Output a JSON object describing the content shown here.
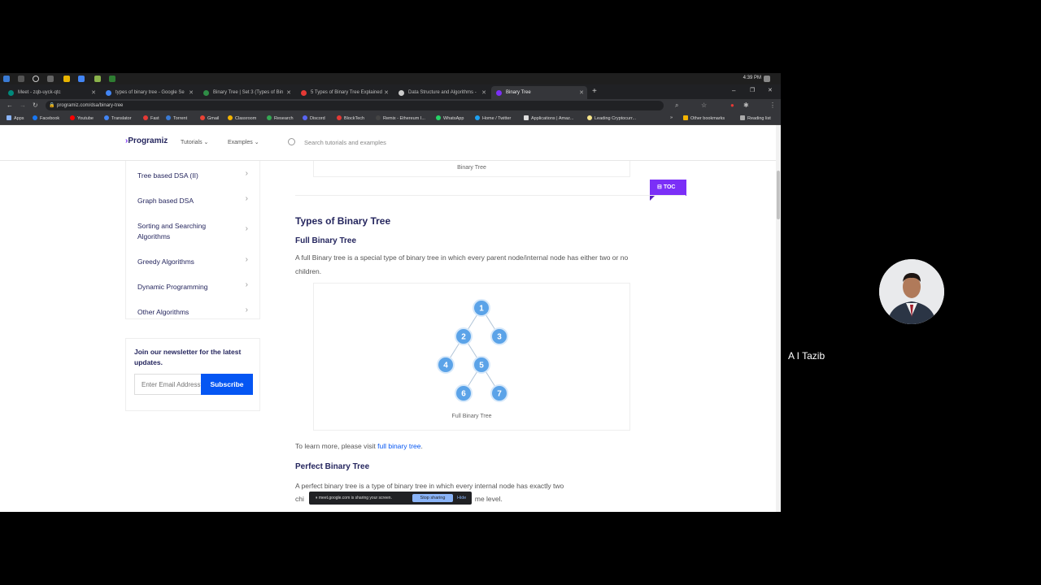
{
  "taskbar": {
    "clock": "4:39 PM"
  },
  "tabs": [
    {
      "label": "Meet - zqb-uyck-qtc",
      "color": "#00897b"
    },
    {
      "label": "types of binary tree - Google Se",
      "color": "#4285f4"
    },
    {
      "label": "Binary Tree | Set 3 (Types of Bin",
      "color": "#2f8d46"
    },
    {
      "label": "5 Types of Binary Tree Explained",
      "color": "#e53935"
    },
    {
      "label": "Data Structure and Algorithms -",
      "color": "#cccccc"
    },
    {
      "label": "Binary Tree",
      "color": "#7b2ff7"
    }
  ],
  "address": {
    "url": "programiz.com/dsa/binary-tree"
  },
  "bookmarks": [
    "Apps",
    "Facebook",
    "Youtube",
    "Translator",
    "Fast",
    "Torrent",
    "Gmail",
    "Classroom",
    "Research",
    "Discord",
    "BlockTech",
    "Remix - Ethereum I...",
    "WhatsApp",
    "Home / Twitter",
    "Applications | Amaz...",
    "Leading Cryptocurr..."
  ],
  "bookmarks_right": [
    "Other bookmarks",
    "Reading list"
  ],
  "header": {
    "logo": "Programiz",
    "nav": [
      "Tutorials",
      "Examples"
    ],
    "search_placeholder": "Search tutorials and examples"
  },
  "sidebar": {
    "items": [
      "Tree based DSA (II)",
      "Graph based DSA",
      "Sorting and Searching Algorithms",
      "Greedy Algorithms",
      "Dynamic Programming",
      "Other Algorithms"
    ]
  },
  "newsletter": {
    "title": "Join our newsletter for the latest updates.",
    "placeholder": "Enter Email Address*",
    "button": "Subscribe"
  },
  "content": {
    "prev_caption": "Binary Tree",
    "toc": "TOC",
    "h2": "Types of Binary Tree",
    "h3_full": "Full Binary Tree",
    "p_full": "A full Binary tree is a special type of binary tree in which every parent node/internal node has either two or no children.",
    "fig_caption": "Full Binary Tree",
    "nodes": [
      "1",
      "2",
      "3",
      "4",
      "5",
      "6",
      "7"
    ],
    "learn_prefix": "To learn more, please visit ",
    "learn_link": "full binary tree",
    "learn_suffix": ".",
    "h3_perfect": "Perfect Binary Tree",
    "p_perfect_1": "A perfect binary tree is a type of binary tree in which every internal node has exactly two",
    "p_perfect_2_start": "chi",
    "p_perfect_2_end": "me level."
  },
  "share_bar": {
    "message": "meet.google.com is sharing your screen.",
    "stop": "Stop sharing",
    "hide": "Hide"
  },
  "participant": {
    "name": "A I Tazib"
  },
  "colors": {
    "accent": "#7b2ff7",
    "link": "#0556f3",
    "node": "#5ba3e8"
  }
}
